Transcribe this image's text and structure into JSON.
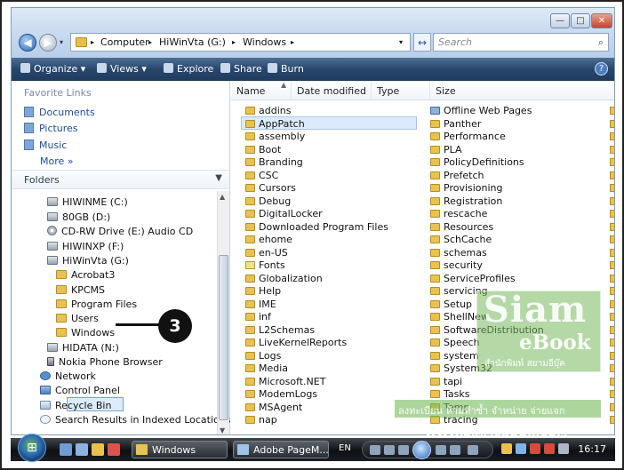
{
  "window": {
    "caption_buttons": [
      "—",
      "□",
      "✕"
    ]
  },
  "address": {
    "crumbs": [
      "Computer",
      "HiWinVta (G:)",
      "Windows"
    ],
    "separators": [
      "▸",
      "▸",
      "▸",
      "▸"
    ],
    "dropdown": "▾",
    "refresh": "↔"
  },
  "search": {
    "placeholder": "Search"
  },
  "toolbar": {
    "organize": "Organize ▾",
    "views": "Views ▾",
    "explore": "Explore",
    "share": "Share",
    "burn": "Burn",
    "help": "?"
  },
  "favorites": {
    "title": "Favorite Links",
    "items": [
      "Documents",
      "Pictures",
      "Music"
    ],
    "more": "More »"
  },
  "folders": {
    "label": "Folders",
    "tree": [
      "HIWINME (C:)",
      "80GB (D:)",
      "CD-RW Drive (E:) Audio CD",
      "HIWINXP (F:)",
      "HiWinVta (G:)",
      "Acrobat3",
      "KPCMS",
      "Program Files",
      "Users",
      "Windows",
      "HIDATA (N:)",
      "Nokia Phone Browser",
      "Network",
      "Control Panel",
      "Recycle Bin",
      "Search Results in Indexed Locations"
    ]
  },
  "callout": {
    "number": "3"
  },
  "columns": [
    "Name",
    "Date modified",
    "Type",
    "Size"
  ],
  "files_left": [
    "addins",
    "AppPatch",
    "assembly",
    "Boot",
    "Branding",
    "CSC",
    "Cursors",
    "Debug",
    "DigitalLocker",
    "Downloaded Program Files",
    "ehome",
    "en-US",
    "Fonts",
    "Globalization",
    "Help",
    "IME",
    "inf",
    "L2Schemas",
    "LiveKernelReports",
    "Logs",
    "Media",
    "Microsoft.NET",
    "ModemLogs",
    "MSAgent",
    "nap"
  ],
  "files_right": [
    "Offline Web Pages",
    "Panther",
    "Performance",
    "PLA",
    "PolicyDefinitions",
    "Prefetch",
    "Provisioning",
    "Registration",
    "rescache",
    "Resources",
    "SchCache",
    "schemas",
    "security",
    "ServiceProfiles",
    "servicing",
    "Setup",
    "ShellNew",
    "SoftwareDistribution",
    "Speech",
    "system",
    "System32",
    "tapi",
    "Tasks",
    "Temp",
    "tracing"
  ],
  "watermark": {
    "siam": "Siam",
    "ebook": "eBook",
    "sub": "สำนักพิมพ์ สยามอีบุ๊ค",
    "banner": "ลงทะเบียน ห้ามทำซ้ำ จำหน่าย จ่ายแจก",
    "url": "WWW.SIAMEBOOK.COM"
  },
  "taskbar": {
    "tasks": [
      "Windows",
      "Adobe PageM..."
    ],
    "lang": "EN",
    "clock": "16:17"
  },
  "colors": {
    "toolbar": "#28466c",
    "link": "#1d4c95",
    "folder": "#e7c351",
    "watermark": "#76ba5c"
  }
}
